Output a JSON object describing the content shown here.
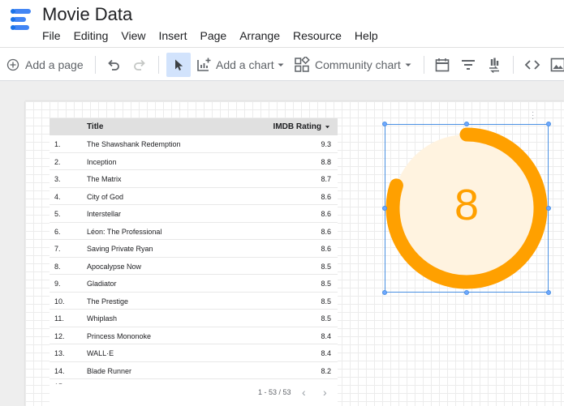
{
  "app": {
    "title": "Movie Data"
  },
  "menu": [
    "File",
    "Editing",
    "View",
    "Insert",
    "Page",
    "Arrange",
    "Resource",
    "Help"
  ],
  "toolbar": {
    "add_page": "Add a page",
    "add_chart": "Add a chart",
    "community_chart": "Community chart"
  },
  "table": {
    "headers": {
      "title": "Title",
      "rating": "IMDB Rating"
    },
    "rows": [
      {
        "idx": "1.",
        "title": "The Shawshank Redemption",
        "rating": "9.3"
      },
      {
        "idx": "2.",
        "title": "Inception",
        "rating": "8.8"
      },
      {
        "idx": "3.",
        "title": "The Matrix",
        "rating": "8.7"
      },
      {
        "idx": "4.",
        "title": "City of God",
        "rating": "8.6"
      },
      {
        "idx": "5.",
        "title": "Interstellar",
        "rating": "8.6"
      },
      {
        "idx": "6.",
        "title": "Léon: The Professional",
        "rating": "8.6"
      },
      {
        "idx": "7.",
        "title": "Saving Private Ryan",
        "rating": "8.6"
      },
      {
        "idx": "8.",
        "title": "Apocalypse Now",
        "rating": "8.5"
      },
      {
        "idx": "9.",
        "title": "Gladiator",
        "rating": "8.5"
      },
      {
        "idx": "10.",
        "title": "The Prestige",
        "rating": "8.5"
      },
      {
        "idx": "11.",
        "title": "Whiplash",
        "rating": "8.5"
      },
      {
        "idx": "12.",
        "title": "Princess Mononoke",
        "rating": "8.4"
      },
      {
        "idx": "13.",
        "title": "WALL·E",
        "rating": "8.4"
      },
      {
        "idx": "14.",
        "title": "Blade Runner",
        "rating": "8.2"
      }
    ],
    "pagination": "1 - 53 / 53"
  },
  "gauge": {
    "value": "8",
    "fraction": 0.8,
    "color": "#ffa000",
    "track_color": "#fff3e0"
  },
  "colors": {
    "selection": "#4a90e2",
    "accent": "#ffa000"
  }
}
